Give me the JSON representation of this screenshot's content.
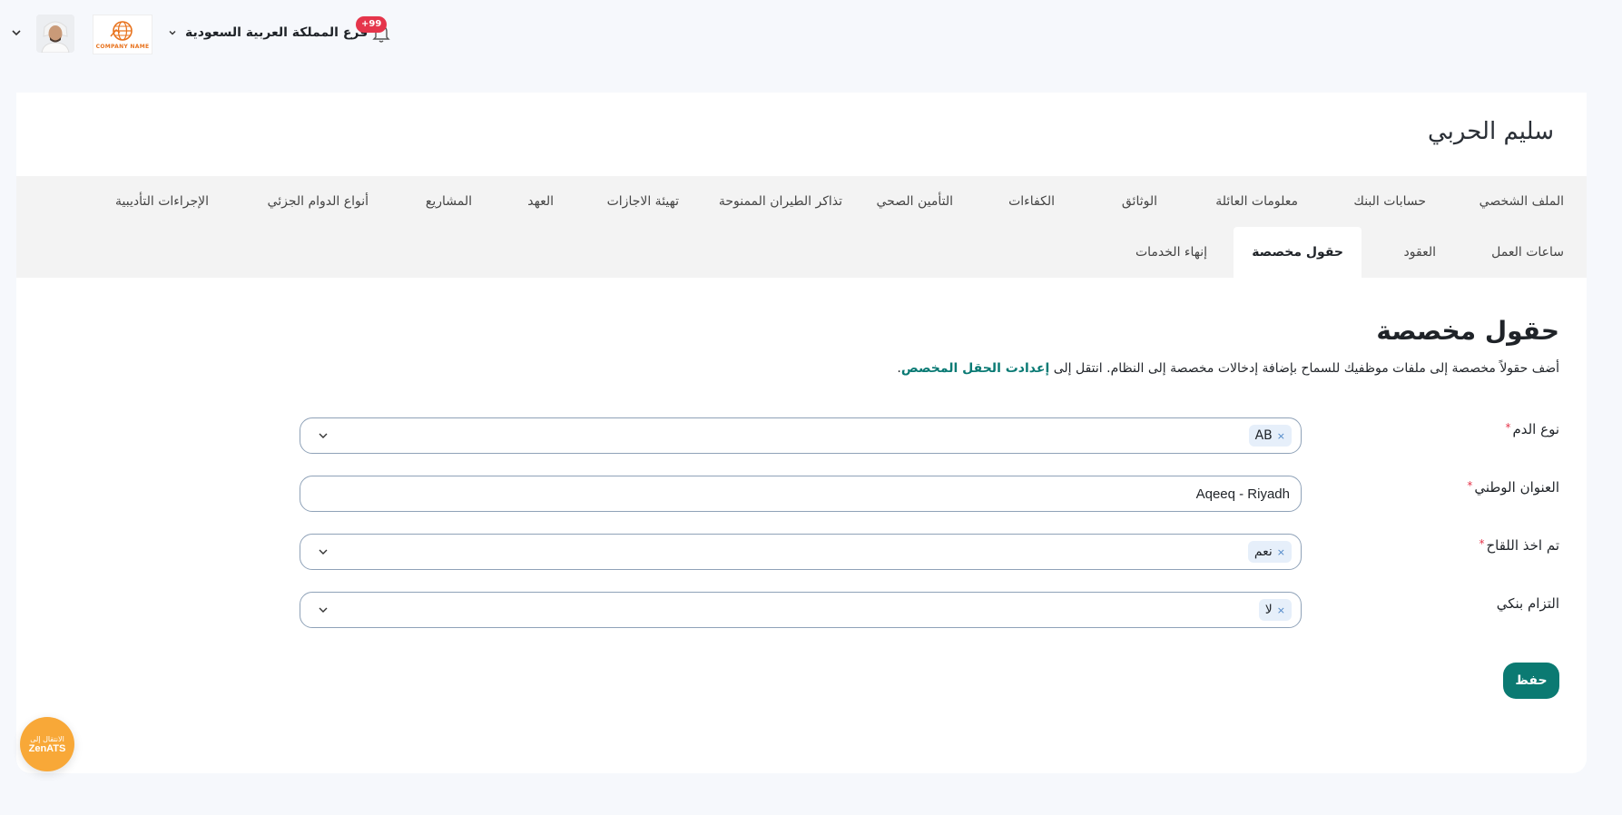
{
  "topbar": {
    "notification_count": "+99",
    "branch_name": "فرع المملكة العربية السعودية",
    "company_logo_text": "COMPANY NAME"
  },
  "profile": {
    "name": "سليم الحربي"
  },
  "tabs": {
    "row1": [
      {
        "label": "الملف الشخصي"
      },
      {
        "label": "حسابات البنك"
      },
      {
        "label": "معلومات العائلة"
      },
      {
        "label": "الوثائق"
      },
      {
        "label": "الكفاءات"
      },
      {
        "label": "التأمين الصحي"
      },
      {
        "label": "تذاكر الطيران الممنوحة"
      },
      {
        "label": "تهيئة الاجازات"
      },
      {
        "label": "العهد"
      },
      {
        "label": "المشاريع"
      },
      {
        "label": "أنواع الدوام الجزئي"
      },
      {
        "label": "الإجراءات التأديبية"
      }
    ],
    "row2": [
      {
        "label": "ساعات العمل"
      },
      {
        "label": "العقود"
      },
      {
        "label": "حقول مخصصة",
        "active": true
      },
      {
        "label": "إنهاء الخدمات"
      }
    ]
  },
  "main": {
    "title": "حقول مخصصة",
    "description_prefix": "أضف حقولاً مخصصة إلى ملفات موظفيك للسماح بإضافة إدخالات مخصصة إلى النظام. انتقل إلى",
    "description_link": "إعدادت الحقل المخصص",
    "description_suffix": ".",
    "fields": {
      "blood_type": {
        "label": "نوع الدم",
        "required": "*",
        "selected": "AB",
        "remove": "×"
      },
      "national_address": {
        "label": "العنوان الوطني",
        "required": "*",
        "value": "Aqeeq - Riyadh"
      },
      "vaccinated": {
        "label": "تم اخذ اللقاح",
        "required": "*",
        "selected": "نعم",
        "remove": "×"
      },
      "bank_commitment": {
        "label": "التزام بنكي",
        "selected": "لا",
        "remove": "×"
      }
    },
    "save_label": "حفظ"
  },
  "zenats": {
    "line1": "الانتقال إلى",
    "line2": "ZenATS"
  }
}
